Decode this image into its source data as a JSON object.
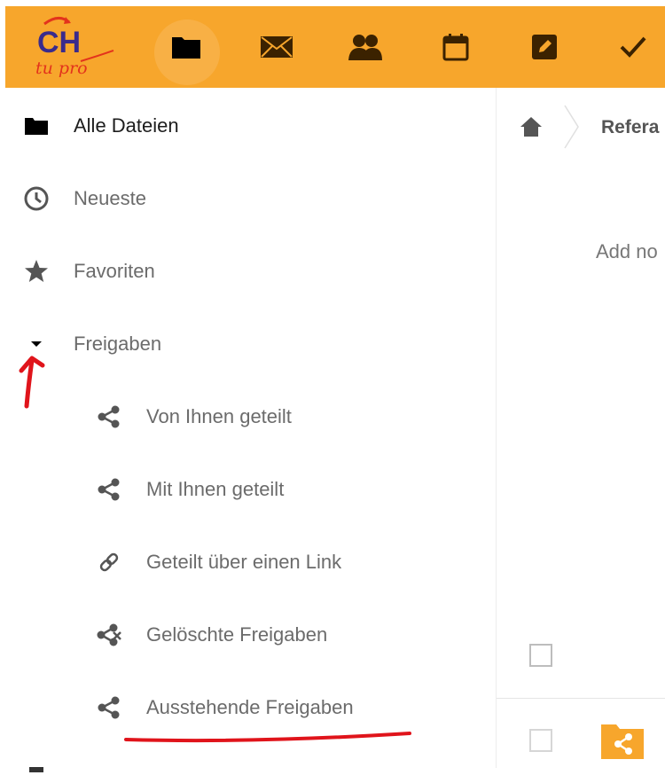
{
  "topbar": {
    "background": "#f7a62c",
    "logo": {
      "name": "app-logo",
      "text_main": "CH",
      "text_sub": "tu pro"
    },
    "apps": [
      {
        "name": "files",
        "icon": "folder-icon",
        "active": true
      },
      {
        "name": "mail",
        "icon": "mail-icon",
        "active": false
      },
      {
        "name": "contacts",
        "icon": "contacts-icon",
        "active": false
      },
      {
        "name": "calendar",
        "icon": "calendar-icon",
        "active": false
      },
      {
        "name": "notes",
        "icon": "notes-icon",
        "active": false
      },
      {
        "name": "tasks",
        "icon": "checkmark-icon",
        "active": false
      }
    ]
  },
  "sidebar": {
    "items": [
      {
        "label": "Alle Dateien",
        "icon": "folder-icon"
      },
      {
        "label": "Neueste",
        "icon": "clock-icon"
      },
      {
        "label": "Favoriten",
        "icon": "star-icon"
      },
      {
        "label": "Freigaben",
        "icon": "caret-down-icon"
      }
    ],
    "sub_items": [
      {
        "label": "Von Ihnen geteilt",
        "icon": "share-icon"
      },
      {
        "label": "Mit Ihnen geteilt",
        "icon": "share-icon"
      },
      {
        "label": "Geteilt über einen Link",
        "icon": "link-icon"
      },
      {
        "label": "Gelöschte Freigaben",
        "icon": "deleted-share-icon"
      },
      {
        "label": "Ausstehende Freigaben",
        "icon": "share-icon"
      }
    ]
  },
  "main": {
    "breadcrumb": {
      "current": "Refera"
    },
    "empty_text": "Add no"
  },
  "annotations": {
    "color": "#e0141b"
  }
}
